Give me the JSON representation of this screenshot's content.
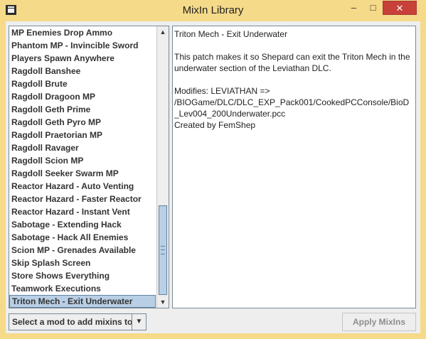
{
  "window": {
    "title": "MixIn Library",
    "icon": "app-window-icon",
    "frame_color": "#f5da89",
    "close_color": "#c7403a",
    "controls": {
      "minimize": "–",
      "maximize": "□",
      "close": "✕"
    }
  },
  "mixin_list": {
    "items": [
      {
        "label": "MP Enemies Drop Ammo"
      },
      {
        "label": "Phantom MP - Invincible Sword"
      },
      {
        "label": "Players Spawn Anywhere"
      },
      {
        "label": "Ragdoll Banshee"
      },
      {
        "label": "Ragdoll Brute"
      },
      {
        "label": "Ragdoll Dragoon MP"
      },
      {
        "label": "Ragdoll Geth Prime"
      },
      {
        "label": "Ragdoll Geth Pyro MP"
      },
      {
        "label": "Ragdoll Praetorian MP"
      },
      {
        "label": "Ragdoll Ravager"
      },
      {
        "label": "Ragdoll Scion MP"
      },
      {
        "label": "Ragdoll Seeker Swarm MP"
      },
      {
        "label": "Reactor Hazard - Auto Venting"
      },
      {
        "label": "Reactor Hazard - Faster Reactor"
      },
      {
        "label": "Reactor Hazard - Instant Vent"
      },
      {
        "label": "Sabotage - Extending Hack"
      },
      {
        "label": "Sabotage - Hack All Enemies"
      },
      {
        "label": "Scion MP - Grenades Available"
      },
      {
        "label": "Skip Splash Screen"
      },
      {
        "label": "Store Shows Everything"
      },
      {
        "label": "Teamwork Executions"
      },
      {
        "label": "Triton Mech - Exit Underwater"
      }
    ],
    "selected_index": 21,
    "selection_color": "#b8cfe5",
    "scrollbar": {
      "up_arrow": "▲",
      "down_arrow": "▼"
    }
  },
  "description": {
    "lines": [
      "Triton Mech - Exit Underwater",
      "",
      "This patch makes it so Shepard can exit the Triton Mech in the",
      "underwater section of the Leviathan DLC.",
      "",
      "Modifies: LEVIATHAN =>",
      "/BIOGame/DLC/DLC_EXP_Pack001/CookedPCConsole/BioD",
      "_Lev004_200Underwater.pcc",
      "Created by FemShep"
    ]
  },
  "footer": {
    "mod_select": {
      "value": "Select a mod to add mixins to",
      "arrow": "▼"
    },
    "apply_label": "Apply MixIns"
  }
}
